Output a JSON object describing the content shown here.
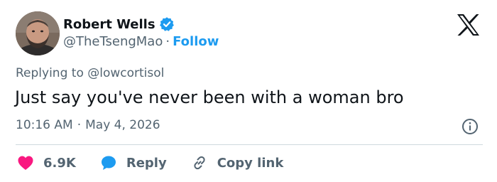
{
  "author": {
    "display_name": "Robert Wells",
    "handle": "@TheTsengMao",
    "separator": "·",
    "follow_label": "Follow",
    "verified": true
  },
  "reply_context": {
    "prefix": "Replying to",
    "mention": "@lowcortisol"
  },
  "tweet": {
    "text": "Just say you've never been with a woman bro",
    "time": "10:16 AM",
    "separator": "·",
    "date": "May 4, 2026"
  },
  "actions": {
    "like_count": "6.9K",
    "reply_label": "Reply",
    "copy_link_label": "Copy link"
  },
  "icons": {
    "logo": "x-logo-icon",
    "verified": "verified-badge-icon",
    "info": "info-icon",
    "like": "heart-icon",
    "reply": "speech-bubble-icon",
    "copy_link": "link-icon"
  },
  "colors": {
    "accent": "#1d9bf0",
    "like": "#f91880",
    "text": "#0f1419",
    "secondary": "#536471",
    "divider": "#cfd9de"
  }
}
